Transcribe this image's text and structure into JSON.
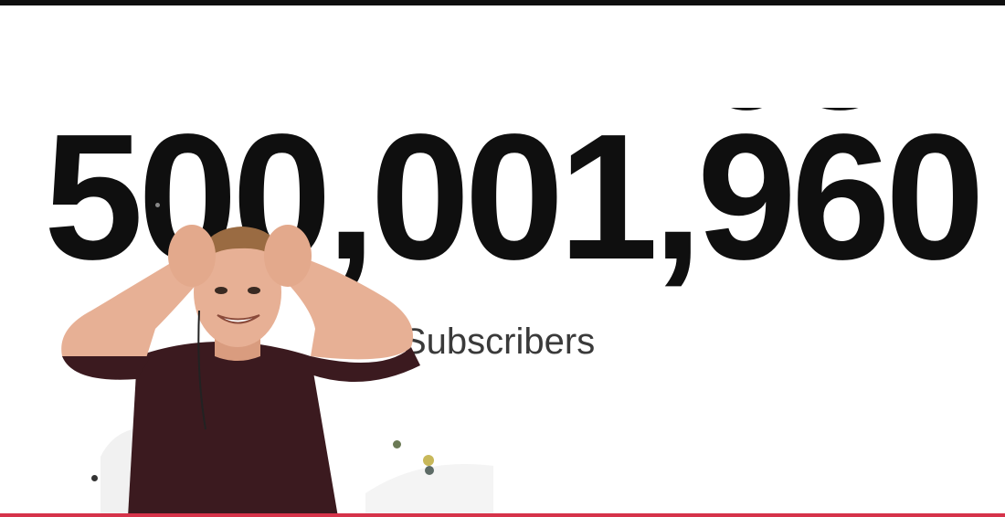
{
  "counter": {
    "prefix": "500,001,",
    "rolling_digits": [
      "9",
      "6"
    ],
    "suffix": "0"
  },
  "label": {
    "subscribers": "Subscribers"
  },
  "colors": {
    "top_bar": "#0f0f0f",
    "bottom_bar": "#d6334a",
    "text": "#0f0f0f",
    "shirt": "#3b1a1f",
    "skin": "#e7b095"
  },
  "icons": {
    "person": "person-cheering-icon"
  }
}
